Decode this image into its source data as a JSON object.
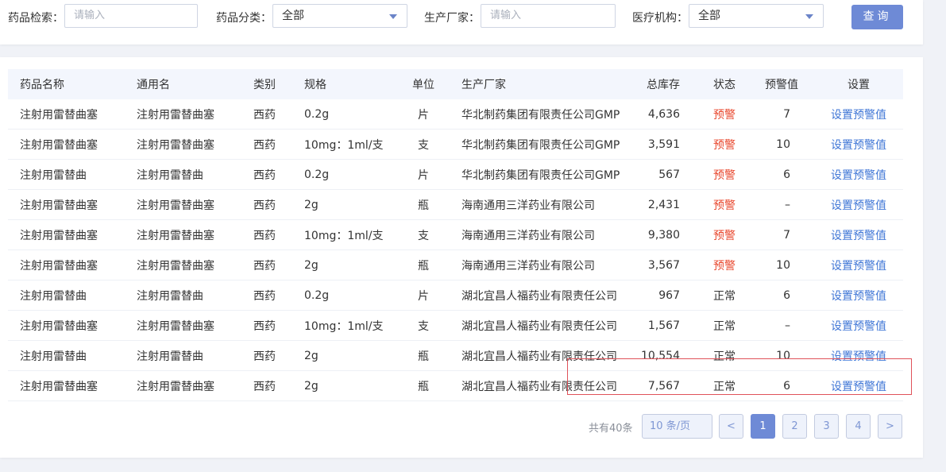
{
  "filters": {
    "drug_search": {
      "label": "药品检索：",
      "placeholder": "请输入"
    },
    "category": {
      "label": "药品分类：",
      "value": "全部"
    },
    "manufacturer": {
      "label": "生产厂家：",
      "placeholder": "请输入"
    },
    "institution": {
      "label": "医疗机构：",
      "value": "全部"
    },
    "query_button": "查询"
  },
  "table": {
    "headers": [
      "药品名称",
      "通用名",
      "类别",
      "规格",
      "单位",
      "生产厂家",
      "总库存",
      "状态",
      "预警值",
      "设置"
    ],
    "rows": [
      {
        "name": "注射用雷替曲塞",
        "generic": "注射用雷替曲塞",
        "type": "西药",
        "spec": "0.2g",
        "unit": "片",
        "maker": "华北制药集团有限责任公司GMP",
        "stock": "4,636",
        "status": "预警",
        "warn": "7",
        "action": "设置预警值"
      },
      {
        "name": "注射用雷替曲塞",
        "generic": "注射用雷替曲塞",
        "type": "西药",
        "spec": "10mg：1ml/支",
        "unit": "支",
        "maker": "华北制药集团有限责任公司GMP",
        "stock": "3,591",
        "status": "预警",
        "warn": "10",
        "action": "设置预警值"
      },
      {
        "name": "注射用雷替曲",
        "generic": "注射用雷替曲",
        "type": "西药",
        "spec": "0.2g",
        "unit": "片",
        "maker": "华北制药集团有限责任公司GMP",
        "stock": "567",
        "status": "预警",
        "warn": "6",
        "action": "设置预警值"
      },
      {
        "name": "注射用雷替曲塞",
        "generic": "注射用雷替曲塞",
        "type": "西药",
        "spec": "2g",
        "unit": "瓶",
        "maker": "海南通用三洋药业有限公司",
        "stock": "2,431",
        "status": "预警",
        "warn": "–",
        "action": "设置预警值"
      },
      {
        "name": "注射用雷替曲塞",
        "generic": "注射用雷替曲塞",
        "type": "西药",
        "spec": "10mg：1ml/支",
        "unit": "支",
        "maker": "海南通用三洋药业有限公司",
        "stock": "9,380",
        "status": "预警",
        "warn": "7",
        "action": "设置预警值"
      },
      {
        "name": "注射用雷替曲塞",
        "generic": "注射用雷替曲塞",
        "type": "西药",
        "spec": "2g",
        "unit": "瓶",
        "maker": "海南通用三洋药业有限公司",
        "stock": "3,567",
        "status": "预警",
        "warn": "10",
        "action": "设置预警值"
      },
      {
        "name": "注射用雷替曲",
        "generic": "注射用雷替曲",
        "type": "西药",
        "spec": "0.2g",
        "unit": "片",
        "maker": "湖北宜昌人福药业有限责任公司",
        "stock": "967",
        "status": "正常",
        "warn": "6",
        "action": "设置预警值"
      },
      {
        "name": "注射用雷替曲塞",
        "generic": "注射用雷替曲塞",
        "type": "西药",
        "spec": "10mg：1ml/支",
        "unit": "支",
        "maker": "湖北宜昌人福药业有限责任公司",
        "stock": "1,567",
        "status": "正常",
        "warn": "–",
        "action": "设置预警值"
      },
      {
        "name": "注射用雷替曲",
        "generic": "注射用雷替曲",
        "type": "西药",
        "spec": "2g",
        "unit": "瓶",
        "maker": "湖北宜昌人福药业有限责任公司",
        "stock": "10,554",
        "status": "正常",
        "warn": "10",
        "action": "设置预警值"
      },
      {
        "name": "注射用雷替曲塞",
        "generic": "注射用雷替曲塞",
        "type": "西药",
        "spec": "2g",
        "unit": "瓶",
        "maker": "湖北宜昌人福药业有限责任公司",
        "stock": "7,567",
        "status": "正常",
        "warn": "6",
        "action": "设置预警值"
      }
    ]
  },
  "pagination": {
    "total_text": "共有40条",
    "page_size": "10 条/页",
    "prev": "<",
    "next": ">",
    "pages": [
      "1",
      "2",
      "3",
      "4"
    ],
    "current": "1"
  },
  "colors": {
    "primary": "#6e8ad6",
    "warning_status": "#e8472d",
    "link": "#3f76d6",
    "header_bg": "#f3f6fd"
  }
}
